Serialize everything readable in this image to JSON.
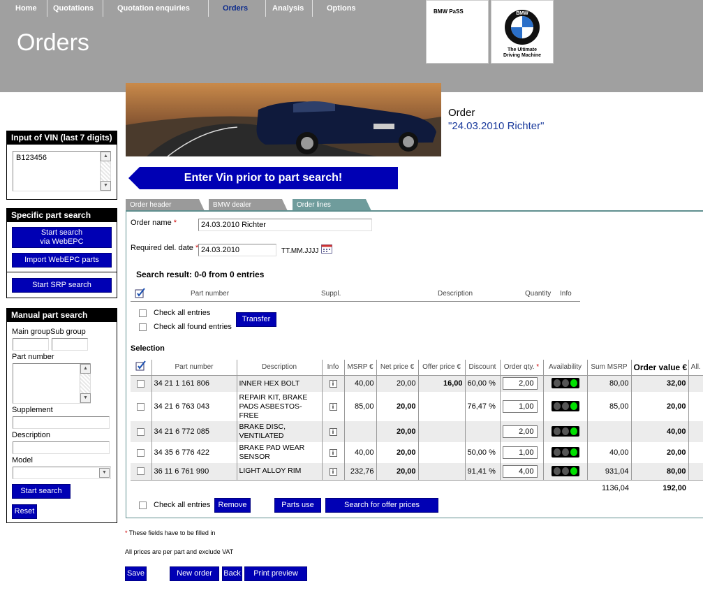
{
  "nav": {
    "items": [
      {
        "label": "Home",
        "active": false
      },
      {
        "label": "Quotations",
        "active": false
      },
      {
        "label": "Quotation enquiries",
        "active": false
      },
      {
        "label": "Orders",
        "active": true
      },
      {
        "label": "Analysis",
        "active": false
      },
      {
        "label": "Options",
        "active": false
      }
    ]
  },
  "page_title": "Orders",
  "brand": {
    "pass_label": "BMW PaSS",
    "logo_letters": "BMW",
    "tagline_line1": "The Ultimate",
    "tagline_line2": "Driving Machine"
  },
  "vin_panel": {
    "title": "Input of VIN (last 7 digits)",
    "value": "B123456"
  },
  "specific_panel": {
    "title": "Specific part search",
    "start_webepc_line1": "Start search",
    "start_webepc_line2": "via WebEPC",
    "import_webepc": "Import WebEPC parts",
    "start_srp": "Start SRP search"
  },
  "manual_panel": {
    "title": "Manual part search",
    "main_group_label": "Main group",
    "sub_group_label": "Sub group",
    "part_number_label": "Part number",
    "supplement_label": "Supplement",
    "description_label": "Description",
    "model_label": "Model",
    "start_search": "Start search",
    "reset": "Reset"
  },
  "order": {
    "heading": "Order",
    "name_quoted": "\"24.03.2010 Richter\""
  },
  "enter_vin_message": "Enter Vin prior to part search!",
  "tabs": [
    {
      "label": "Order header",
      "color": "#9a9a9a"
    },
    {
      "label": "BMW dealer",
      "color": "#9a9a9a"
    },
    {
      "label": "Order lines",
      "color": "#6f9c9c"
    }
  ],
  "form": {
    "order_name_label": "Order name",
    "order_name_value": "24.03.2010 Richter",
    "req_date_label": "Required del. date",
    "req_date_value": "24.03.2010",
    "date_format": "TT.MM.JJJJ",
    "required_mark": "*"
  },
  "search_result": {
    "title": "Search result: 0-0 from 0 entries",
    "columns": [
      "Part number",
      "Suppl.",
      "Description",
      "Quantity",
      "Info"
    ],
    "check_all_entries": "Check all entries",
    "check_all_found": "Check all found entries",
    "transfer": "Transfer"
  },
  "selection": {
    "title": "Selection",
    "columns": [
      "Part number",
      "Description",
      "Info",
      "MSRP €",
      "Net price €",
      "Offer price €",
      "Discount",
      "Order qty.",
      "Availability",
      "Sum MSRP",
      "Order value €",
      "All."
    ],
    "rows": [
      {
        "part": "34 21 1 161 806",
        "desc": "INNER HEX BOLT",
        "msrp": "40,00",
        "net": "20,00",
        "net_bold": false,
        "offer": "16,00",
        "discount": "60,00 %",
        "qty": "2,00",
        "sum_msrp": "80,00",
        "value": "32,00"
      },
      {
        "part": "34 21 6 763 043",
        "desc": "REPAIR KIT, BRAKE PADS ASBESTOS-FREE",
        "msrp": "85,00",
        "net": "20,00",
        "net_bold": true,
        "offer": "",
        "discount": "76,47 %",
        "qty": "1,00",
        "sum_msrp": "85,00",
        "value": "20,00"
      },
      {
        "part": "34 21 6 772 085",
        "desc": "BRAKE DISC, VENTILATED",
        "msrp": "",
        "net": "20,00",
        "net_bold": true,
        "offer": "",
        "discount": "",
        "qty": "2,00",
        "sum_msrp": "",
        "value": "40,00"
      },
      {
        "part": "34 35 6 776 422",
        "desc": "BRAKE PAD WEAR SENSOR",
        "msrp": "40,00",
        "net": "20,00",
        "net_bold": true,
        "offer": "",
        "discount": "50,00 %",
        "qty": "1,00",
        "sum_msrp": "40,00",
        "value": "20,00"
      },
      {
        "part": "36 11 6 761 990",
        "desc": "LIGHT ALLOY RIM",
        "msrp": "232,76",
        "net": "20,00",
        "net_bold": true,
        "offer": "",
        "discount": "91,41 %",
        "qty": "4,00",
        "sum_msrp": "931,04",
        "value": "80,00"
      }
    ],
    "total_sum_msrp": "1136,04",
    "total_value": "192,00",
    "check_all_entries": "Check all entries",
    "remove": "Remove",
    "parts_use": "Parts use",
    "search_offer": "Search for offer prices"
  },
  "footer": {
    "required_note": "These fields have to be filled in",
    "vat_note": "All prices are per part and exclude VAT",
    "save": "Save",
    "new_order": "New order",
    "back": "Back",
    "print_preview": "Print preview"
  },
  "colors": {
    "accent_blue": "#0000b4",
    "header_gray": "#a0a0a0",
    "active_nav": "#0b2a8c",
    "avail_green": "#00e000"
  }
}
